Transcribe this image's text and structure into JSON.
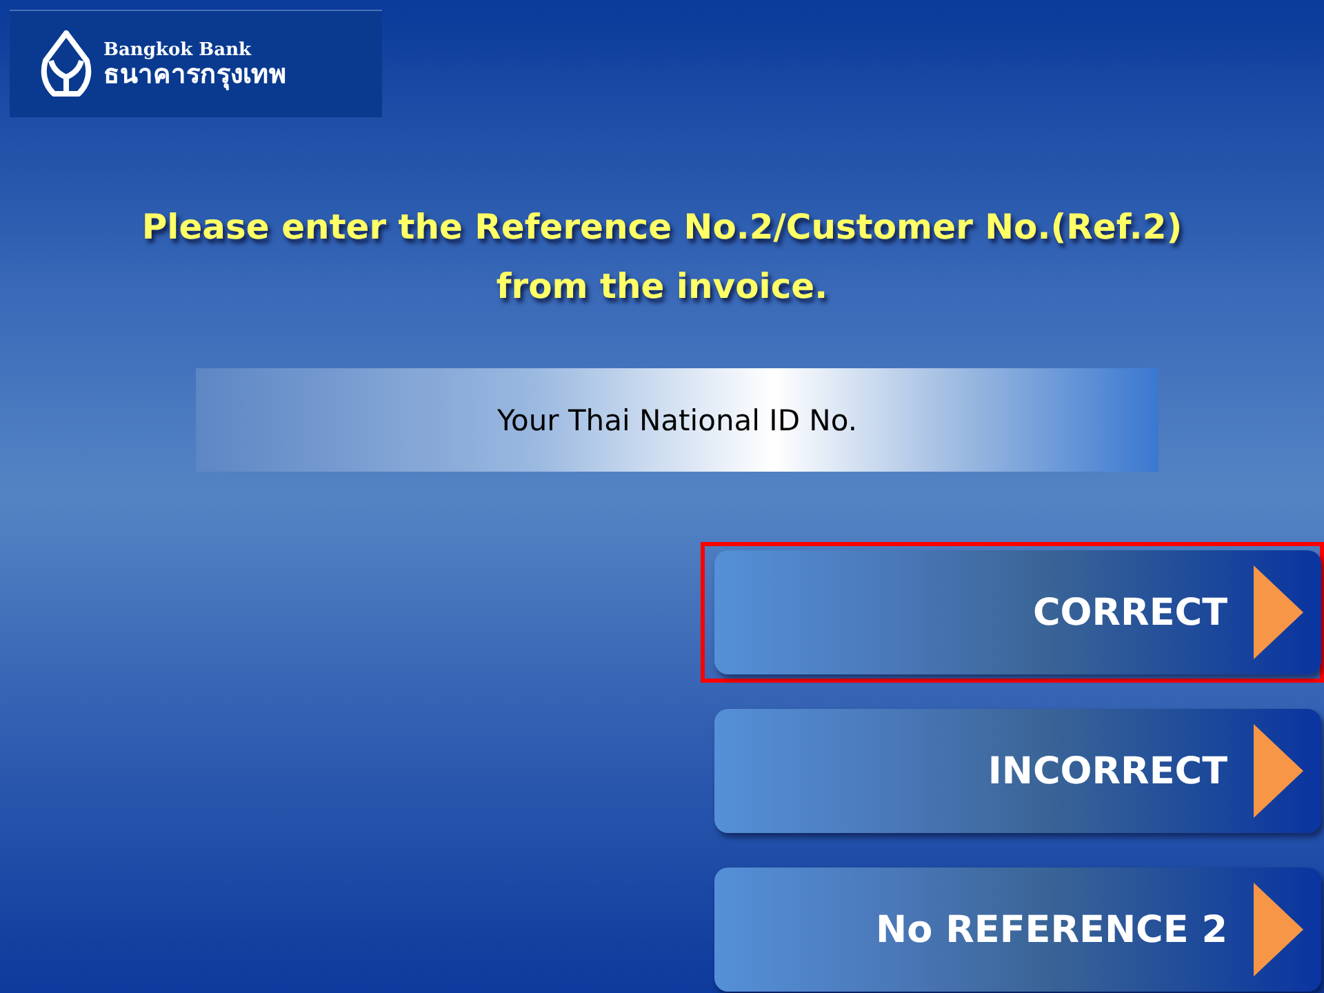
{
  "logo": {
    "name": "Bangkok Bank",
    "thai_name": "ธนาคารกรุงเทพ"
  },
  "prompt": {
    "lines": [
      "Please enter the Reference No.2/Customer No.(Ref.2)",
      "from the invoice."
    ]
  },
  "field": {
    "value": "Your Thai National ID No."
  },
  "buttons": [
    {
      "label": "CORRECT",
      "selected": true
    },
    {
      "label": "INCORRECT",
      "selected": false
    },
    {
      "label": "No REFERENCE 2",
      "selected": false
    }
  ]
}
